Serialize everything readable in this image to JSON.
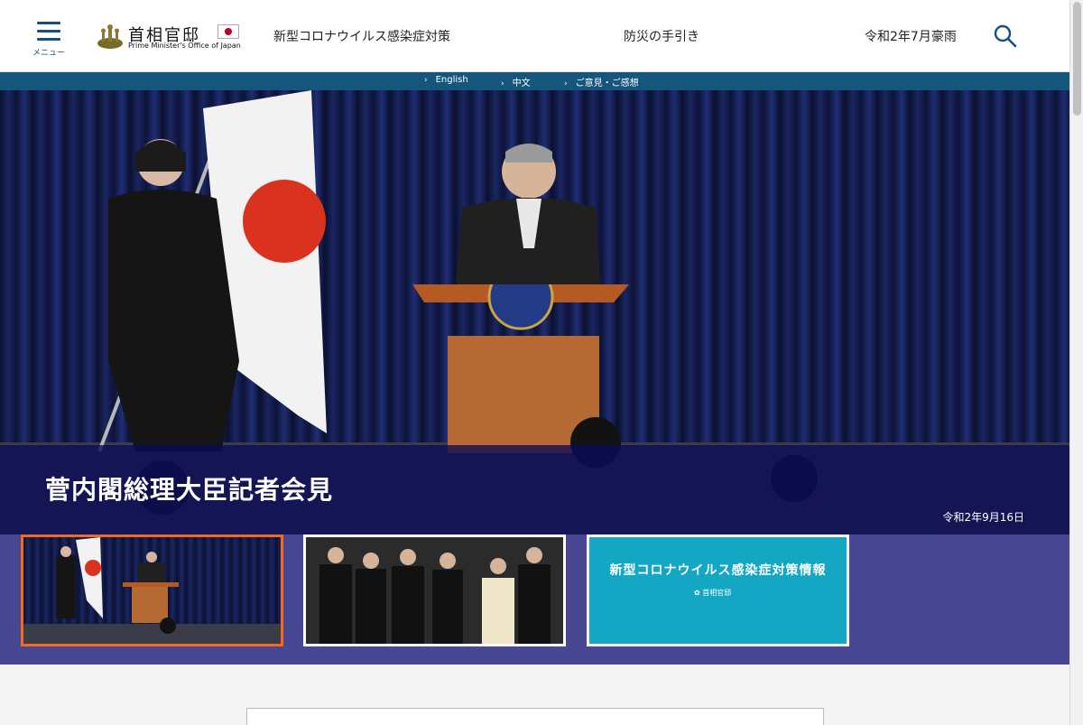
{
  "header": {
    "menu_label": "メニュー",
    "logo_jp": "首相官邸",
    "logo_en": "Prime Minister's Office of Japan",
    "nav": [
      {
        "label": "新型コロナウイルス感染症対策"
      },
      {
        "label": "防災の手引き"
      },
      {
        "label": "令和2年7月豪雨"
      }
    ]
  },
  "subnav": [
    {
      "label": "English"
    },
    {
      "label": "中文"
    },
    {
      "label": "ご意見・ご感想"
    }
  ],
  "hero": {
    "title": "菅内閣総理大臣記者会見",
    "date": "令和2年9月16日"
  },
  "thumbnails": [
    {
      "state": "active"
    },
    {
      "state": "inactive"
    },
    {
      "state": "inactive",
      "title": "新型コロナウイルス感染症対策情報",
      "logo_text": "首相官邸"
    }
  ],
  "colors": {
    "brand_blue": "#16567d",
    "caption_bg": "#0c0a5a",
    "thumb_strip": "#4a4792",
    "active_border": "#f26a21",
    "covid_teal": "#14a7c4"
  },
  "icons": {
    "menu": "hamburger-icon",
    "search": "search-icon",
    "subnav_arrow": "chevron-right-icon"
  }
}
